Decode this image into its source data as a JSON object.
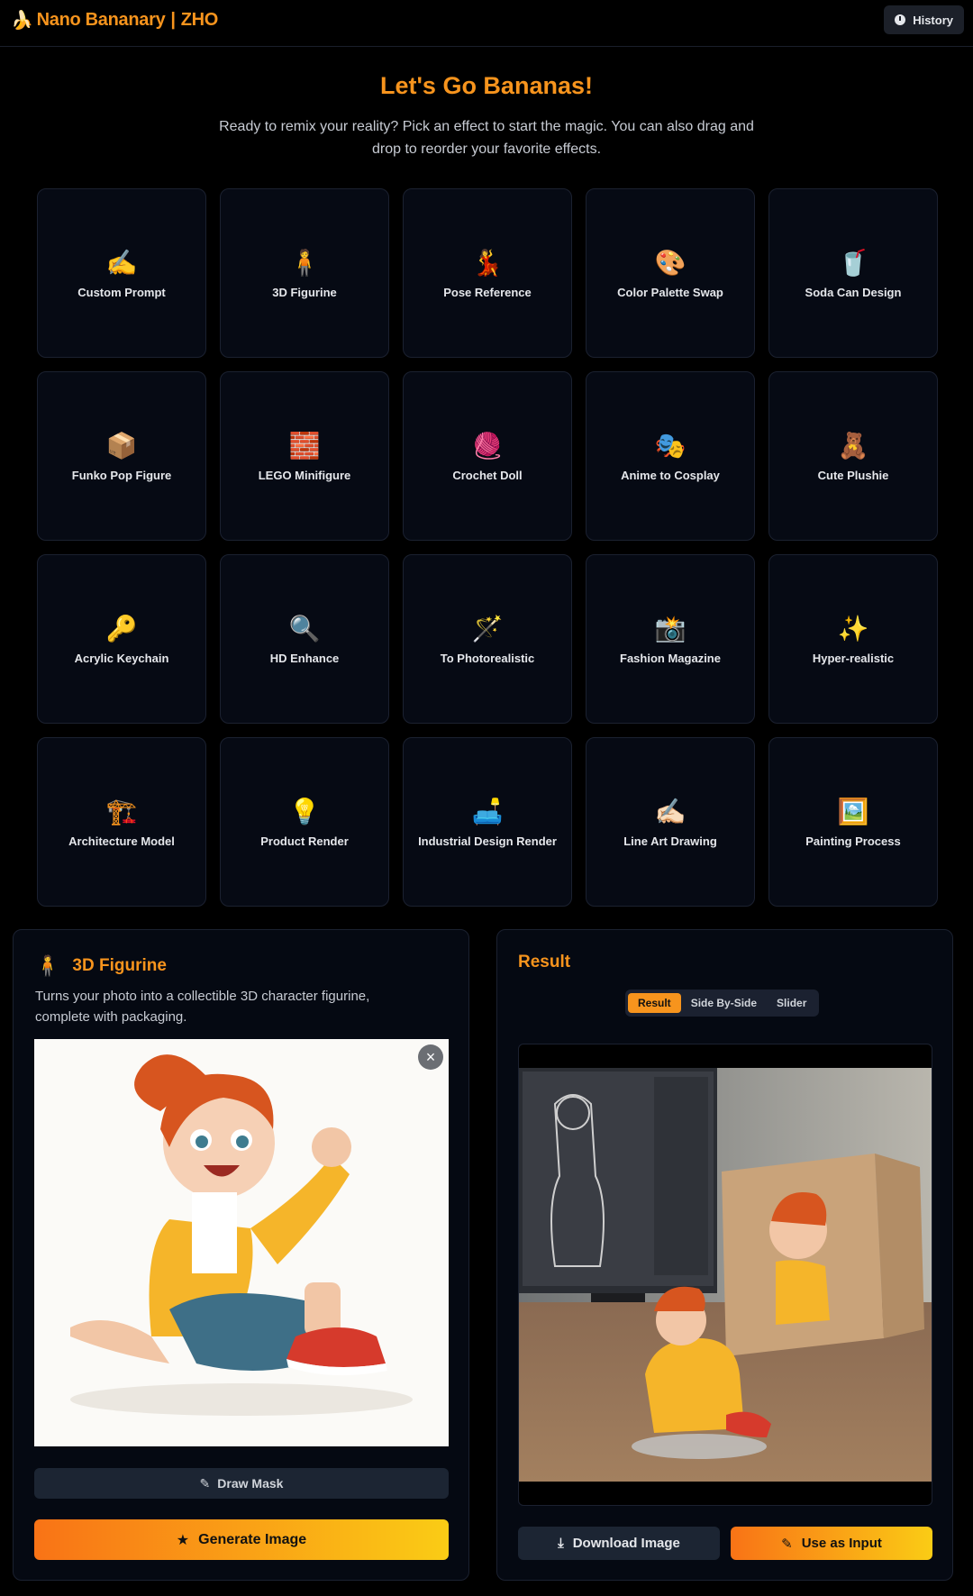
{
  "header": {
    "logo_mark": "🍌",
    "brand": "Nano Bananary",
    "separator": "|",
    "author": "ZHO",
    "history_label": "History"
  },
  "hero": {
    "title": "Let's Go Bananas!",
    "subtitle": "Ready to remix your reality? Pick an effect to start the magic. You can also drag and drop to reorder your favorite effects."
  },
  "effects": [
    {
      "emoji": "✍️",
      "label": "Custom Prompt"
    },
    {
      "emoji": "🧍",
      "label": "3D Figurine"
    },
    {
      "emoji": "💃",
      "label": "Pose Reference"
    },
    {
      "emoji": "🎨",
      "label": "Color Palette Swap"
    },
    {
      "emoji": "🥤",
      "label": "Soda Can Design"
    },
    {
      "emoji": "📦",
      "label": "Funko Pop Figure"
    },
    {
      "emoji": "🧱",
      "label": "LEGO Minifigure"
    },
    {
      "emoji": "🧶",
      "label": "Crochet Doll"
    },
    {
      "emoji": "🎭",
      "label": "Anime to Cosplay"
    },
    {
      "emoji": "🧸",
      "label": "Cute Plushie"
    },
    {
      "emoji": "🔑",
      "label": "Acrylic Keychain"
    },
    {
      "emoji": "🔍",
      "label": "HD Enhance"
    },
    {
      "emoji": "🪄",
      "label": "To Photorealistic"
    },
    {
      "emoji": "📸",
      "label": "Fashion Magazine"
    },
    {
      "emoji": "✨",
      "label": "Hyper-realistic"
    },
    {
      "emoji": "🏗️",
      "label": "Architecture Model"
    },
    {
      "emoji": "💡",
      "label": "Product Render"
    },
    {
      "emoji": "🛋️",
      "label": "Industrial Design Render"
    },
    {
      "emoji": "✍🏻",
      "label": "Line Art Drawing"
    },
    {
      "emoji": "🖼️",
      "label": "Painting Process"
    }
  ],
  "selected_effect": {
    "emoji": "🧍",
    "title": "3D Figurine",
    "description": "Turns your photo into a collectible 3D character figurine, complete with packaging.",
    "close_symbol": "×",
    "draw_mask_label": "Draw Mask",
    "generate_label": "Generate Image"
  },
  "result": {
    "title": "Result",
    "view_tabs": [
      "Result",
      "Side By-Side",
      "Slider"
    ],
    "active_tab": "Result",
    "download_label": "Download Image",
    "use_as_input_label": "Use as Input"
  },
  "colors": {
    "accent": "#f7941d",
    "gradient_start": "#f97316",
    "gradient_end": "#facc15",
    "card_bg": "#060a14",
    "border": "#1b2130"
  }
}
